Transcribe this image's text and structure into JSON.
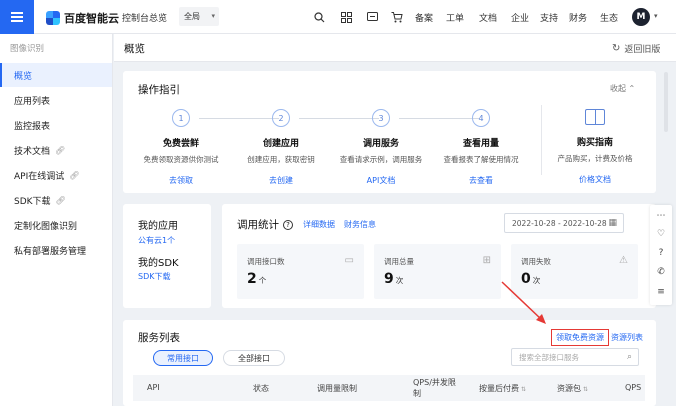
{
  "topbar": {
    "brand": "百度智能云",
    "console_link": "控制台总览",
    "region": "全局",
    "nav": [
      "备案",
      "工单",
      "文档",
      "企业",
      "支持",
      "财务",
      "生态"
    ],
    "avatar_letter": "M",
    "icons": [
      "search-icon",
      "grid-icon",
      "message-icon",
      "cart-icon"
    ]
  },
  "sidebar": {
    "title": "图像识别",
    "items": [
      {
        "label": "概览",
        "active": true
      },
      {
        "label": "应用列表"
      },
      {
        "label": "监控报表"
      },
      {
        "label": "技术文档",
        "external": true
      },
      {
        "label": "API在线调试",
        "external": true
      },
      {
        "label": "SDK下载",
        "external": true
      },
      {
        "label": "定制化图像识别"
      },
      {
        "label": "私有部署服务管理"
      }
    ]
  },
  "main": {
    "title": "概览",
    "back_old": "返回旧版"
  },
  "guide": {
    "title": "操作指引",
    "collapse": "收起",
    "steps": [
      {
        "num": "1",
        "name": "免费尝鲜",
        "desc": "免费领取资源供你测试",
        "link": "去领取"
      },
      {
        "num": "2",
        "name": "创建应用",
        "desc": "创建应用，获取密钥",
        "link": "去创建"
      },
      {
        "num": "3",
        "name": "调用服务",
        "desc": "查看请求示例，调用服务",
        "link": "API文档"
      },
      {
        "num": "4",
        "name": "查看用量",
        "desc": "查看报表了解使用情况",
        "link": "去查看"
      }
    ],
    "buy": {
      "name": "购买指南",
      "desc": "产品购买，计费及价格",
      "link": "价格文档"
    }
  },
  "my_app": {
    "title": "我的应用",
    "cloud_link": "公有云1个",
    "sdk_title": "我的SDK",
    "sdk_link": "SDK下载"
  },
  "stats": {
    "title": "调用统计",
    "detail_link": "详细数据",
    "finance_link": "财务信息",
    "date_range": "2022-10-28 - 2022-10-28",
    "boxes": [
      {
        "label": "调用接口数",
        "value": "2",
        "unit": "个",
        "icon": "monitor-icon"
      },
      {
        "label": "调用总量",
        "value": "9",
        "unit": "次",
        "icon": "grid-icon"
      },
      {
        "label": "调用失败",
        "value": "0",
        "unit": "次",
        "icon": "warning-icon"
      }
    ]
  },
  "services": {
    "title": "服务列表",
    "claim_link": "领取免费资源",
    "resource_link": "资源列表",
    "tabs": [
      "常用接口",
      "全部接口"
    ],
    "search_placeholder": "搜索全部接口服务",
    "columns": [
      "API",
      "状态",
      "调用量限制",
      "QPS/并发限制",
      "按量后付费",
      "资源包",
      "QPS"
    ]
  },
  "float_bar": [
    "thumbs-icon",
    "heart-icon",
    "help-icon",
    "phone-icon",
    "list-icon"
  ],
  "colors": {
    "accent": "#2468f2",
    "highlight_box": "#e53935"
  }
}
